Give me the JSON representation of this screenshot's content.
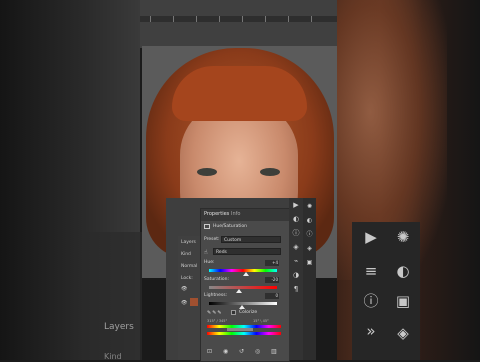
{
  "properties_panel": {
    "tab_properties": "Properties",
    "tab_info": "Info",
    "adjustment_name": "Hue/Saturation",
    "preset_label": "Preset:",
    "preset_value": "Custom",
    "channel_value": "Reds",
    "hue_label": "Hue:",
    "hue_value": "+4",
    "saturation_label": "Saturation:",
    "saturation_value": "-20",
    "lightness_label": "Lightness:",
    "lightness_value": "0",
    "colorize_label": "Colorize",
    "range_left": "315° / 345°",
    "range_right": "15° \\ 45°"
  },
  "layers_panel": {
    "title": "Layers",
    "kind_label": "Kind",
    "blend_mode": "Normal",
    "lock_label": "Lock:"
  },
  "background": {
    "layers_label": "Layers",
    "kind_label": "Kind"
  },
  "icons": {
    "toolbar": [
      "play-icon",
      "adjust-icon",
      "info-icon",
      "layers-icon",
      "brush-icon",
      "circle-half-icon",
      "paragraph-icon"
    ],
    "bigbar": [
      "play-icon",
      "virus-icon",
      "sliders-icon",
      "circle-half-icon",
      "info-icon",
      "layers-icon",
      "shape-icon"
    ]
  },
  "colors": {
    "panel_bg": "#4a4a4a",
    "toolbar_bg": "#333333",
    "hair": "#a5451d"
  }
}
